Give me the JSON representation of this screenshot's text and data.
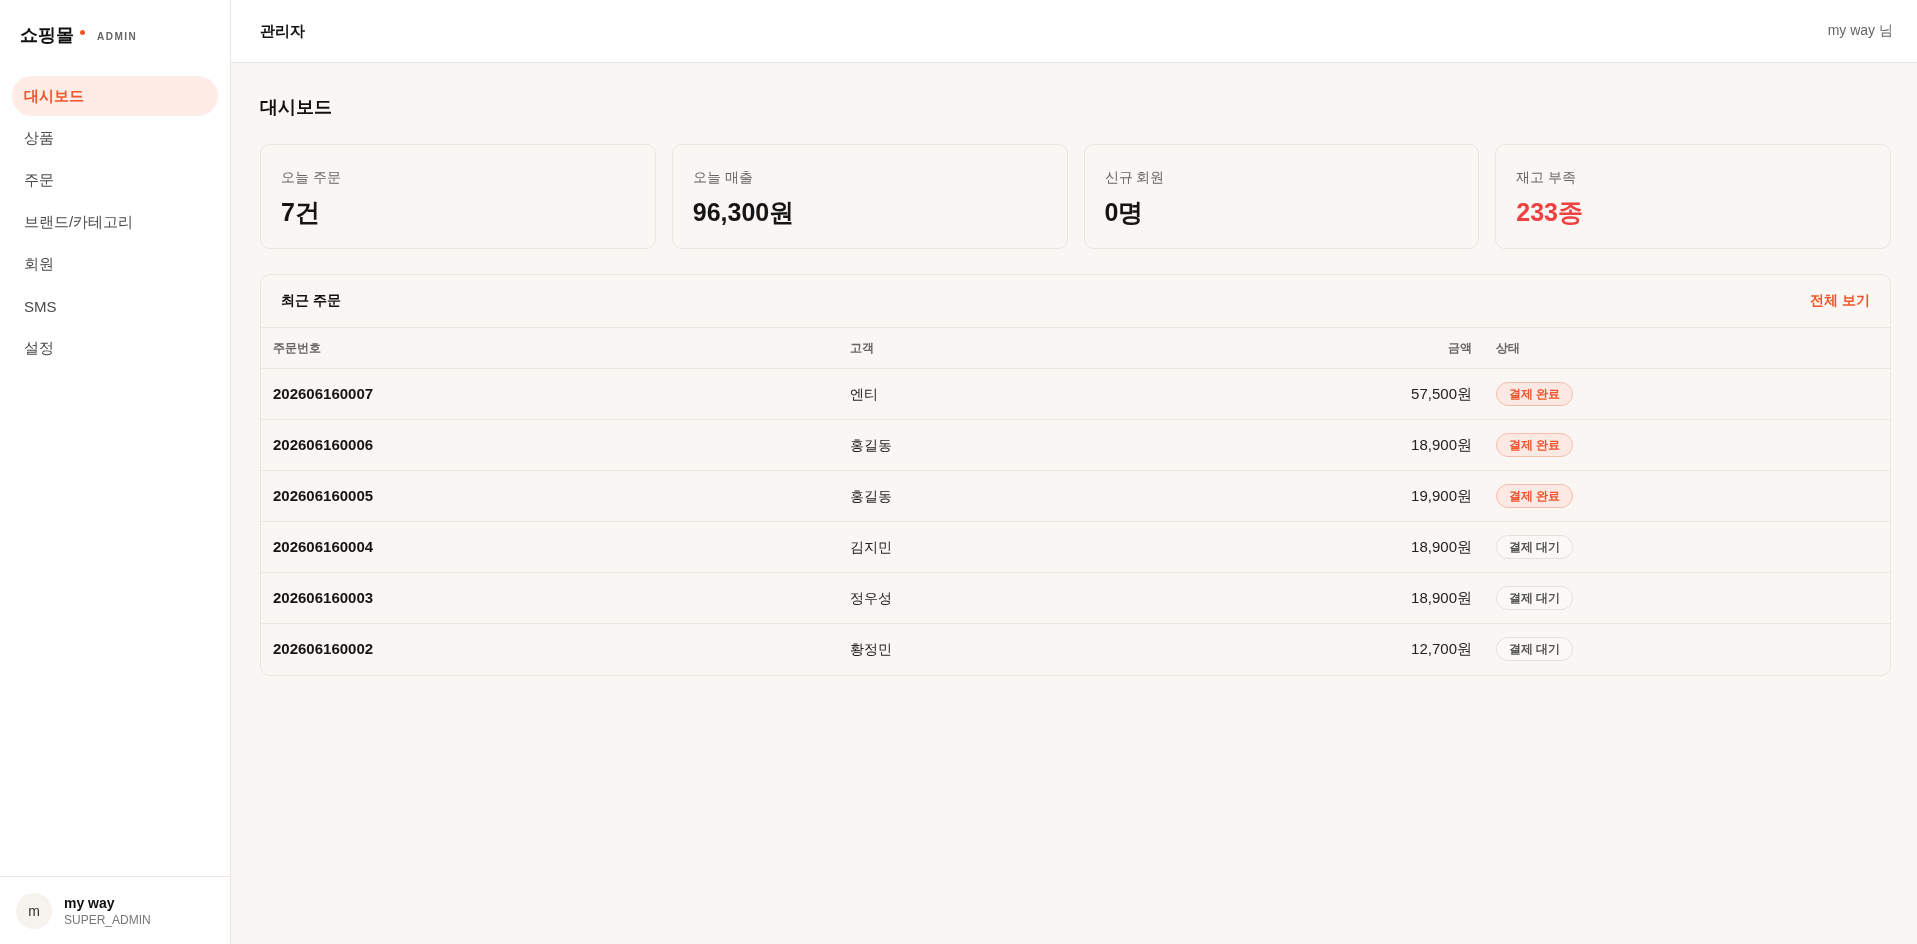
{
  "sidebar": {
    "logo": {
      "title": "쇼핑몰",
      "badge": "ADMIN"
    },
    "items": [
      {
        "label": "대시보드",
        "selected": true
      },
      {
        "label": "상품",
        "selected": false
      },
      {
        "label": "주문",
        "selected": false
      },
      {
        "label": "브랜드/카테고리",
        "selected": false
      },
      {
        "label": "회원",
        "selected": false
      },
      {
        "label": "SMS",
        "selected": false
      },
      {
        "label": "설정",
        "selected": false
      }
    ],
    "user": {
      "avatar": "m",
      "name": "my way",
      "role": "SUPER_ADMIN"
    }
  },
  "header": {
    "title": "관리자",
    "user": "my way 님"
  },
  "page": {
    "title": "대시보드"
  },
  "stats": [
    {
      "label": "오늘 주문",
      "value": "7건",
      "warning": false
    },
    {
      "label": "오늘 매출",
      "value": "96,300원",
      "warning": false
    },
    {
      "label": "신규 회원",
      "value": "0명",
      "warning": false
    },
    {
      "label": "재고 부족",
      "value": "233종",
      "warning": true
    }
  ],
  "recent_orders": {
    "title": "최근 주문",
    "link": "전체 보기",
    "columns": [
      "주문번호",
      "고객",
      "금액",
      "상태"
    ],
    "rows": [
      {
        "order_no": "202606160007",
        "customer": "엔티",
        "amount": "57,500원",
        "status": {
          "label": "결제 완료",
          "kind": "paid"
        }
      },
      {
        "order_no": "202606160006",
        "customer": "홍길동",
        "amount": "18,900원",
        "status": {
          "label": "결제 완료",
          "kind": "paid"
        }
      },
      {
        "order_no": "202606160005",
        "customer": "홍길동",
        "amount": "19,900원",
        "status": {
          "label": "결제 완료",
          "kind": "paid"
        }
      },
      {
        "order_no": "202606160004",
        "customer": "김지민",
        "amount": "18,900원",
        "status": {
          "label": "결제 대기",
          "kind": "pending"
        }
      },
      {
        "order_no": "202606160003",
        "customer": "정우성",
        "amount": "18,900원",
        "status": {
          "label": "결제 대기",
          "kind": "pending"
        }
      },
      {
        "order_no": "202606160002",
        "customer": "황정민",
        "amount": "12,700원",
        "status": {
          "label": "결제 대기",
          "kind": "pending"
        }
      }
    ]
  }
}
